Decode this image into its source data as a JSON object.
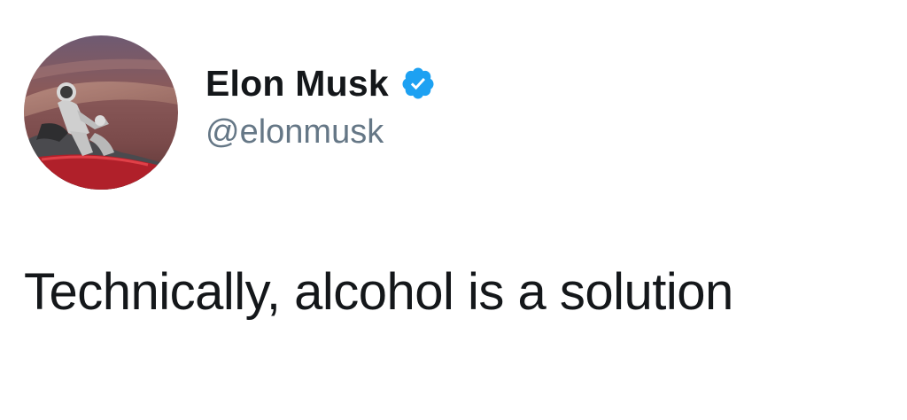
{
  "tweet": {
    "author": {
      "display_name": "Elon Musk",
      "handle": "@elonmusk",
      "verified": true,
      "verified_badge_color": "#1da1f2"
    },
    "text": "Technically, alcohol is a solution"
  },
  "icons": {
    "verified": "verified-badge-icon"
  },
  "colors": {
    "name": "#14171a",
    "handle": "#657786",
    "text": "#14171a",
    "background": "#ffffff"
  }
}
